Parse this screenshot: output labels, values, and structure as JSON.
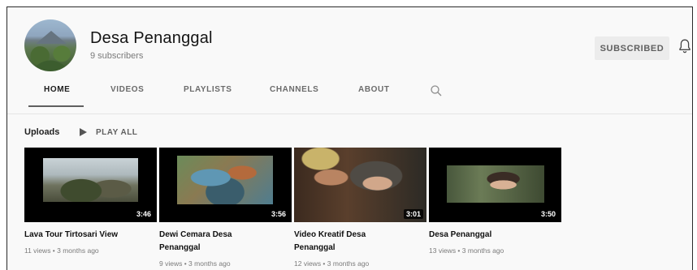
{
  "channel": {
    "name": "Desa Penanggal",
    "subscribers": "9 subscribers",
    "subscribe_label": "SUBSCRIBED"
  },
  "tabs": [
    {
      "label": "HOME",
      "active": true
    },
    {
      "label": "VIDEOS",
      "active": false
    },
    {
      "label": "PLAYLISTS",
      "active": false
    },
    {
      "label": "CHANNELS",
      "active": false
    },
    {
      "label": "ABOUT",
      "active": false
    }
  ],
  "uploads": {
    "title": "Uploads",
    "play_all_label": "PLAY ALL"
  },
  "videos": [
    {
      "title": "Lava Tour Tirtosari View",
      "meta": "11 views • 3 months ago",
      "duration": "3:46"
    },
    {
      "title": "Dewi Cemara Desa Penanggal",
      "meta": "9 views • 3 months ago",
      "duration": "3:56"
    },
    {
      "title": "Video Kreatif Desa Penanggal",
      "meta": "12 views • 3 months ago",
      "duration": "3:01"
    },
    {
      "title": "Desa Penanggal",
      "meta": "13 views • 3 months ago",
      "duration": "3:50"
    }
  ],
  "icons": {
    "bell": "bell-icon",
    "search": "search-icon",
    "play": "play-icon"
  },
  "colors": {
    "background": "#f9f9f9",
    "text": "#0f0f0f",
    "secondary_text": "#606060",
    "button_background": "#ececec",
    "duration_badge": "#000000"
  }
}
